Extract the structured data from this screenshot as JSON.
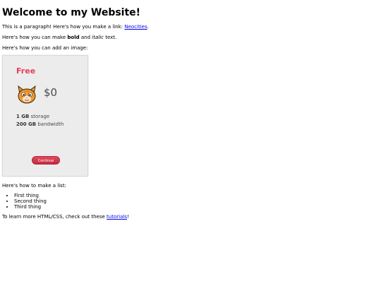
{
  "page": {
    "heading": "Welcome to my Website!",
    "para1_text": "This is a paragraph! Here's how you make a link: ",
    "para1_link": "Neocities",
    "para1_end": ".",
    "para2_start": "Here's how you can make ",
    "para2_bold": "bold",
    "para2_middle": " and ",
    "para2_italic": "italic",
    "para2_end": " text.",
    "para3_text": "Here's how you can add an image:",
    "para4_text": "Here's how to make a list:",
    "list_items": [
      "First thing",
      "Second thing",
      "Third thing"
    ],
    "para5_text": "To learn more HTML/CSS, check out these ",
    "para5_link": "tutorials",
    "para5_end": "!"
  },
  "plan_card": {
    "name": "Free",
    "price": "$0",
    "storage_amount": "1 GB",
    "storage_label": " storage",
    "bandwidth_amount": "200 GB",
    "bandwidth_label": " bandwidth",
    "button_label": "Continue",
    "icon": "cat-icon"
  },
  "colors": {
    "link": "#0000ee",
    "plan_name": "#e63f5b",
    "button": "#d33a4e"
  }
}
